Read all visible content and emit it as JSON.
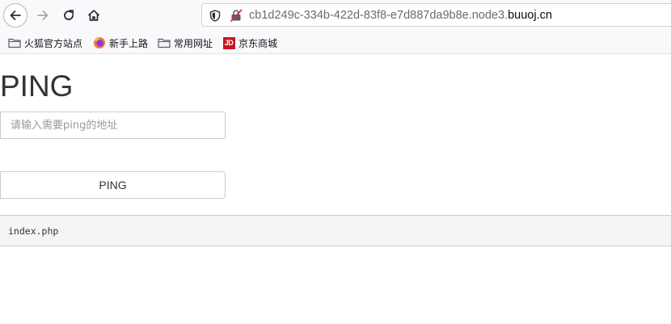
{
  "browser": {
    "url": {
      "prefix": "cb1d249c-334b-422d-83f8-e7d887da9b8e.node3.",
      "domain": "buuoj.cn"
    },
    "nav_icons": [
      "back-arrow-icon",
      "forward-arrow-icon",
      "reload-icon",
      "home-icon"
    ],
    "url_icons": [
      "tracking-shield-icon",
      "insecure-connection-icon"
    ]
  },
  "bookmarks": [
    {
      "label": "火狐官方站点",
      "icon": "folder-icon"
    },
    {
      "label": "新手上路",
      "icon": "firefox-icon"
    },
    {
      "label": "常用网址",
      "icon": "folder-icon"
    },
    {
      "label": "京东商城",
      "icon": "jd-icon",
      "icon_text": "JD"
    }
  ],
  "page": {
    "title": "PING",
    "input_placeholder": "请输入需要ping的地址",
    "input_value": "",
    "button_label": "PING",
    "output": "index.php"
  },
  "colors": {
    "toolbar_bg": "#f9f9fb",
    "jd_red": "#c91623",
    "insecure_red": "#e22850",
    "output_bg": "#f5f5f5"
  }
}
